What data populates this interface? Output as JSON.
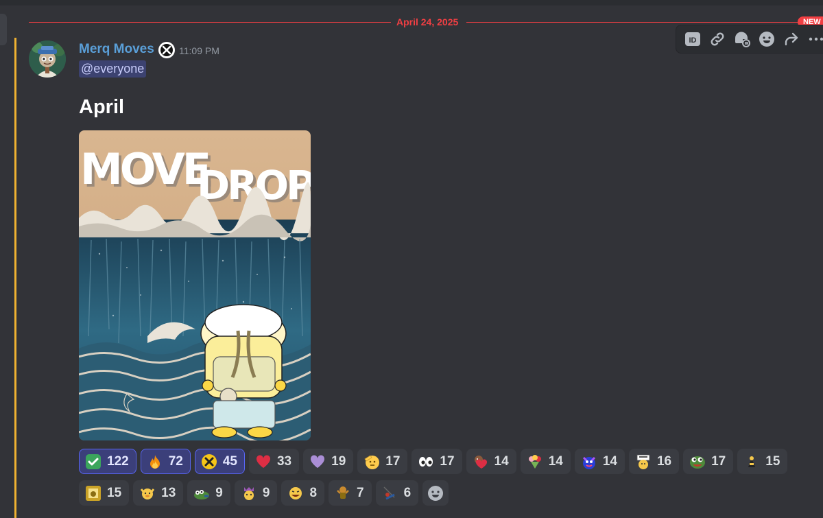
{
  "divider": {
    "date": "April 24, 2025",
    "new_label": "NEW"
  },
  "message": {
    "username": "Merq Moves",
    "timestamp": "11:09 PM",
    "mention": "@everyone",
    "heading": "April",
    "attachment": {
      "title_part1": "MOVE",
      "title_part2": "DROP"
    }
  },
  "toolbar": {
    "icons": [
      "id-icon",
      "link-icon",
      "thread-icon",
      "emoji-icon",
      "forward-icon",
      "more-icon"
    ]
  },
  "colors": {
    "accent_red": "#f23f43",
    "username": "#5a9fd8",
    "mention_bar": "#f0b232",
    "reaction_me_border": "#5865f2"
  },
  "reactions": [
    {
      "emoji": "check-mark-icon",
      "count": "122",
      "me": true
    },
    {
      "emoji": "fire-icon",
      "count": "72",
      "me": true
    },
    {
      "emoji": "server-badge-icon",
      "count": "45",
      "me": true
    },
    {
      "emoji": "red-heart-icon",
      "count": "33",
      "me": false
    },
    {
      "emoji": "purple-heart-icon",
      "count": "19",
      "me": false
    },
    {
      "emoji": "saluting-face-icon",
      "count": "17",
      "me": false
    },
    {
      "emoji": "eyes-icon",
      "count": "17",
      "me": false
    },
    {
      "emoji": "hugging-heart-icon",
      "count": "14",
      "me": false
    },
    {
      "emoji": "heart-bouquet-icon",
      "count": "14",
      "me": false
    },
    {
      "emoji": "blue-creature-icon",
      "count": "14",
      "me": false
    },
    {
      "emoji": "sign-holding-icon",
      "count": "16",
      "me": false
    },
    {
      "emoji": "pepe-frog-icon",
      "count": "17",
      "me": false
    },
    {
      "emoji": "tiny-character-icon",
      "count": "15",
      "me": false
    },
    {
      "emoji": "gold-frame-icon",
      "count": "15",
      "me": false
    },
    {
      "emoji": "cheering-duck-icon",
      "count": "13",
      "me": false
    },
    {
      "emoji": "lying-frog-icon",
      "count": "9",
      "me": false
    },
    {
      "emoji": "crowned-duck-icon",
      "count": "9",
      "me": false
    },
    {
      "emoji": "laughing-duck-icon",
      "count": "8",
      "me": false
    },
    {
      "emoji": "dancing-duck-icon",
      "count": "7",
      "me": false
    },
    {
      "emoji": "swing-icon",
      "count": "6",
      "me": false
    }
  ]
}
